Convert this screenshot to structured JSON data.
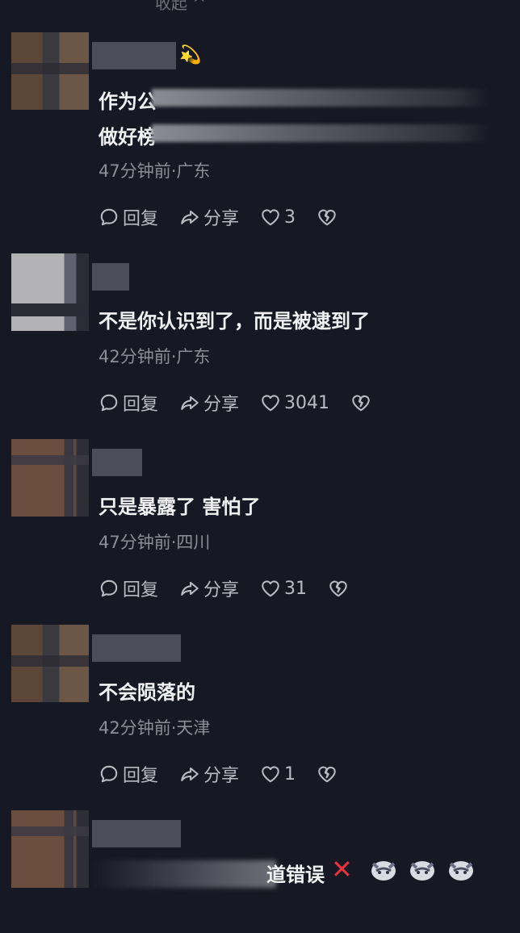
{
  "collapse_label": "收起 ^",
  "comments": [
    {
      "text_prefix": "作为公",
      "text_line2_prefix": "做好榜",
      "meta": "47分钟前·广东",
      "actions": {
        "reply": "回复",
        "share": "分享",
        "likes": "3"
      }
    },
    {
      "text": "不是你认识到了，而是被逮到了",
      "meta": "42分钟前·广东",
      "actions": {
        "reply": "回复",
        "share": "分享",
        "likes": "3041"
      }
    },
    {
      "text": "只是暴露了 害怕了",
      "meta": "47分钟前·四川",
      "actions": {
        "reply": "回复",
        "share": "分享",
        "likes": "31"
      }
    },
    {
      "text": "不会陨落的",
      "meta": "42分钟前·天津",
      "actions": {
        "reply": "回复",
        "share": "分享",
        "likes": "1"
      }
    },
    {
      "text_suffix": "道错误"
    }
  ],
  "icons": {
    "reply": "comment-bubble-icon",
    "share": "share-arrow-icon",
    "like": "heart-icon",
    "dislike": "broken-heart-icon"
  },
  "colors": {
    "background": "#161823",
    "meta": "#8c8d96",
    "redx": "#e8323c"
  }
}
